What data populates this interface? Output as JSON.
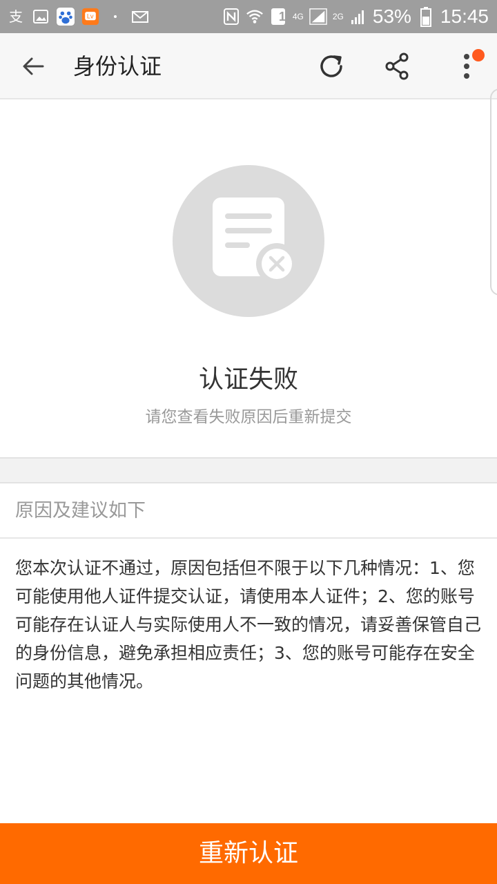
{
  "status_bar": {
    "battery": "53%",
    "time": "15:45",
    "network_4g": "4G",
    "network_2g": "2G",
    "sim": "1",
    "icons": [
      "alipay-icon",
      "gallery-icon",
      "baidu-icon",
      "app-icon",
      "dot-icon",
      "mail-icon",
      "nfc-icon",
      "wifi-icon",
      "sim-icon",
      "signal-icon",
      "signal-icon",
      "battery-icon"
    ]
  },
  "toolbar": {
    "title": "身份认证",
    "icons": [
      "back-arrow-icon",
      "refresh-icon",
      "share-icon",
      "more-vertical-icon"
    ],
    "notification_color": "#ff5a1f"
  },
  "result": {
    "icon": "document-failed-icon",
    "title": "认证失败",
    "subtitle": "请您查看失败原因后重新提交"
  },
  "reasons": {
    "header": "原因及建议如下",
    "body": "您本次认证不通过，原因包括但不限于以下几种情况：1、您可能使用他人证件提交认证，请使用本人证件；2、您的账号可能存在认证人与实际使用人不一致的情况，请妥善保管自己的身份信息，避免承担相应责任；3、您的账号可能存在安全问题的其他情况。"
  },
  "action": {
    "button_label": "重新认证",
    "accent_color": "#ff6a00"
  }
}
